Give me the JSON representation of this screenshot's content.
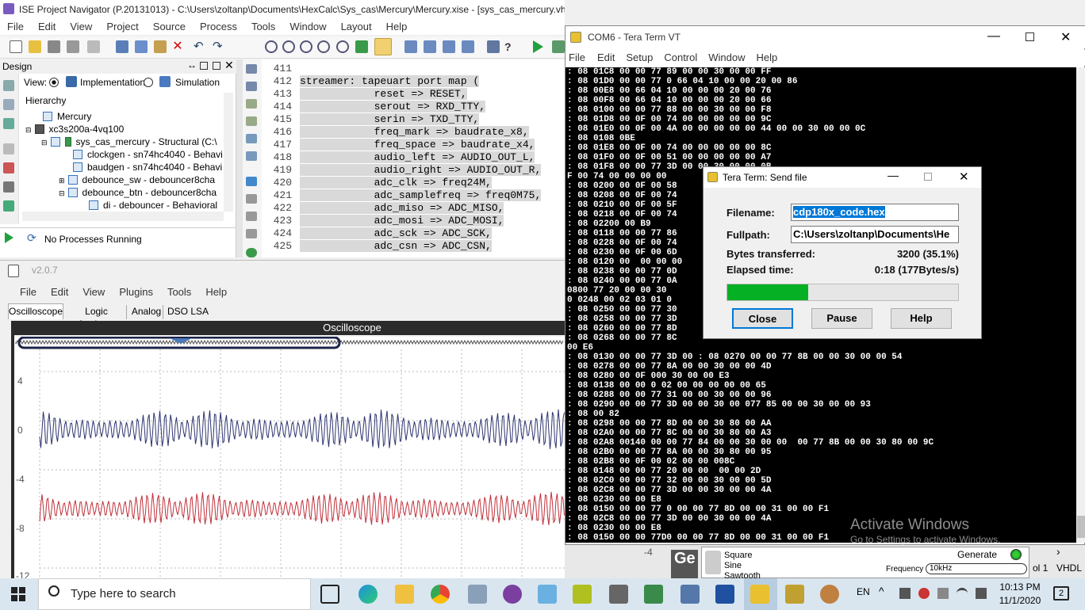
{
  "ise": {
    "title": "ISE Project Navigator (P.20131013) - C:\\Users\\zoltanp\\Documents\\HexCalc\\Sys_cas\\Mercury\\Mercury.xise - [sys_cas_mercury.vhd]",
    "menu": [
      "File",
      "Edit",
      "View",
      "Project",
      "Source",
      "Process",
      "Tools",
      "Window",
      "Layout",
      "Help"
    ],
    "design": {
      "header": "Design",
      "view_label": "View:",
      "view_impl": "Implementation",
      "view_sim": "Simulation",
      "hierarchy_label": "Hierarchy",
      "tree": [
        "Mercury",
        "xc3s200a-4vq100",
        "sys_cas_mercury - Structural (C:\\",
        "clockgen - sn74hc4040 - Behavi",
        "baudgen - sn74hc4040 - Behavi",
        "debounce_sw - debouncer8cha",
        "debounce_btn - debouncer8cha",
        "di - debouncer - Behavioral"
      ],
      "process_status": "No Processes Running"
    },
    "code": [
      {
        "ln": "411",
        "text": ""
      },
      {
        "ln": "412",
        "text": "streamer: tapeuart port map ("
      },
      {
        "ln": "413",
        "text": "            reset => RESET,"
      },
      {
        "ln": "414",
        "text": "            serout => RXD_TTY,"
      },
      {
        "ln": "415",
        "text": "            serin => TXD_TTY,"
      },
      {
        "ln": "416",
        "text": "            freq_mark => baudrate_x8,"
      },
      {
        "ln": "417",
        "text": "            freq_space => baudrate_x4,"
      },
      {
        "ln": "418",
        "text": "            audio_left => AUDIO_OUT_L,"
      },
      {
        "ln": "419",
        "text": "            audio_right => AUDIO_OUT_R,"
      },
      {
        "ln": "420",
        "text": "            adc_clk => freq24M,"
      },
      {
        "ln": "421",
        "text": "            adc_samplefreq => freq0M75,"
      },
      {
        "ln": "422",
        "text": "            adc_miso => ADC_MISO,"
      },
      {
        "ln": "423",
        "text": "            adc_mosi => ADC_MOSI,"
      },
      {
        "ln": "424",
        "text": "            adc_sck => ADC_SCK,"
      },
      {
        "ln": "425",
        "text": "            adc_csn => ADC_CSN,"
      }
    ]
  },
  "osc": {
    "version": "v2.0.7",
    "menu": [
      "File",
      "Edit",
      "View",
      "Plugins",
      "Tools",
      "Help"
    ],
    "tabs": [
      "Oscilloscope",
      "Logic Analyzer",
      "Analog",
      "DSO LSA"
    ],
    "plot_title": "Oscilloscope",
    "y_ticks": [
      "4",
      "0",
      "-4",
      "-8",
      "-12"
    ],
    "right_tick": "-4",
    "colors": {
      "ch1": "#2e3570",
      "ch2": "#c0303a"
    },
    "gen": {
      "waveforms": [
        "Square",
        "Sine",
        "Sawtooth"
      ],
      "generate_label": "Generate",
      "frequency_label": "Frequency",
      "frequency_value": "10kHz"
    },
    "side_label": "ol 1",
    "vhdl_label": "VHDL"
  },
  "term": {
    "title": "COM6 - Tera Term VT",
    "menu": [
      "File",
      "Edit",
      "Setup",
      "Control",
      "Window",
      "Help"
    ],
    "lines": [
      ": 08 01C8 00 00 77 89 00 00 30 00 00 FF",
      ": 08 01D0 00 00 77 0 66 04 10 00 00 20 00 86",
      ": 08 00E8 00 66 04 10 00 00 00 20 00 76",
      ": 08 00F8 00 66 04 10 00 00 00 20 00 66",
      ": 08 0100 00 00 77 88 00 00 30 00 00 F8",
      ": 08 01D8 00 0F 00 74 00 00 00 00 00 9C",
      ": 08 01E0 00 0F 00 4A 00 00 00 00 00 44 00 00 30 00 00 0C",
      ": 08 0108 0BE",
      ": 08 01E8 00 0F 00 74 00 00 00 00 00 8C",
      ": 08 01F0 00 0F 00 51 00 00 00 00 00 A7",
      ": 08 01F8 00 00 77 3D 00 00 30 00 00 0B",
      "F 00 74 00 00 00 00                                                  6B",
      ": 08 0200 00 0F 00 58",
      ": 08 0208 00 0F 00 74",
      ": 08 0210 00 0F 00 5F",
      ": 08 0218 00 0F 00 74",
      ": 08 02200 00 B9",
      ": 08 0118 00 00 77 86",
      ": 08 0228 00 0F 00 74",
      ": 08 0230 00 0F 00 6D",
      ": 08 0120 00  00 00 00",
      ": 08 0238 00 00 77 0D",
      ": 08 0240 00 00 77 0A",
      "0800 77 20 00 00 30",
      "0 0248 00 02 03 01 0",
      ": 08 0250 00 00 77 30",
      ": 08 0258 00 00 77 3D                                               0 BA",
      ": 08 0260 00 00 77 8D",
      ": 08 0268 00 00 77 8C",
      "00 E6",
      ": 08 0130 00 00 77 3D 00 : 08 0270 00 00 77 8B 00 00 30 00 00 54",
      ": 08 0278 00 00 77 8A 00 00 30 00 00 4D",
      ": 08 0280 00 0F 000 30 00 00 E3",
      ": 08 0138 00 00 0 02 00 00 00 00 00 65",
      ": 08 0288 00 00 77 31 00 00 30 00 00 96",
      ": 08 0290 00 00 77 3D 00 00 30 00 077 85 00 00 30 00 00 93",
      ": 08 00 82",
      ": 08 0298 00 00 77 8D 00 00 30 80 00 AA",
      ": 08 02A0 00 00 77 8C 00 00 30 80 00 A3",
      ": 08 02A8 00140 00 00 77 84 00 00 30 00 00  00 77 8B 00 00 30 80 00 9C",
      ": 08 02B0 00 00 77 8A 00 00 30 80 00 95",
      ": 08 02B8 00 0F 00 02 00 00 008C",
      ": 08 0148 00 00 77 20 00 00  00 00 2D",
      ": 08 02C0 00 00 77 32 00 00 30 00 00 5D",
      ": 08 02C8 00 00 77 3D 00 00 30 00 00 4A",
      ": 08 0230 00 00 E8",
      ": 08 0150 00 00 77 0 00 00 77 8D 00 00 31 00 00 F1",
      ": 08 02C8 00 00 77 3D 00 00 30 00 00 4A",
      ": 08 0230 00 00 E8",
      ": 08 0150 00 00 77D0 00 00 77 8D 00 00 31 00 00 F1"
    ]
  },
  "dialog": {
    "title": "Tera Term: Send file",
    "filename_label": "Filename:",
    "filename_value": "cdp180x_code.hex",
    "fullpath_label": "Fullpath:",
    "fullpath_value": "C:\\Users\\zoltanp\\Documents\\He",
    "bytes_label": "Bytes transferred:",
    "bytes_value": "3200 (35.1%)",
    "elapsed_label": "Elapsed time:",
    "elapsed_value": "0:18 (177Bytes/s)",
    "progress": 0.351,
    "close_label": "Close",
    "pause_label": "Pause",
    "help_label": "Help"
  },
  "watermark": {
    "line1": "Activate Windows",
    "line2": "Go to Settings to activate Windows."
  },
  "taskbar": {
    "search_placeholder": "Type here to search",
    "lang": "EN",
    "time": "10:13 PM",
    "date": "11/1/2020",
    "notif_count": "2"
  }
}
